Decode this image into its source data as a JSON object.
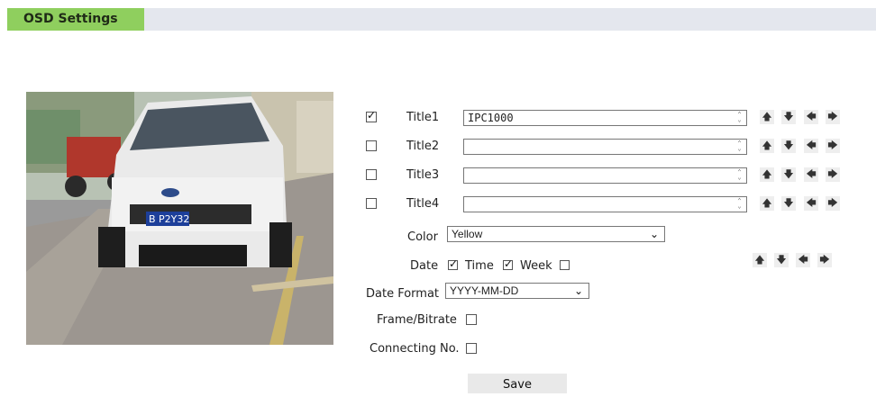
{
  "header": {
    "title": "OSD Settings"
  },
  "titles": [
    {
      "label": "Title1",
      "checked": true,
      "value": "IPC1000"
    },
    {
      "label": "Title2",
      "checked": false,
      "value": ""
    },
    {
      "label": "Title3",
      "checked": false,
      "value": ""
    },
    {
      "label": "Title4",
      "checked": false,
      "value": ""
    }
  ],
  "color": {
    "label": "Color",
    "value": "Yellow"
  },
  "date": {
    "label": "Date",
    "date_checked": true,
    "time_label": "Time",
    "time_checked": true,
    "week_label": "Week",
    "week_checked": false
  },
  "date_format": {
    "label": "Date Format",
    "value": "YYYY-MM-DD"
  },
  "frame_bitrate": {
    "label": "Frame/Bitrate",
    "checked": false
  },
  "connecting_no": {
    "label": "Connecting No.",
    "checked": false
  },
  "save": {
    "label": "Save"
  },
  "preview": {
    "plate_text": "B P2Y32"
  },
  "colors": {
    "tab": "#8fcf5e",
    "header_bar": "#e4e7ee"
  }
}
